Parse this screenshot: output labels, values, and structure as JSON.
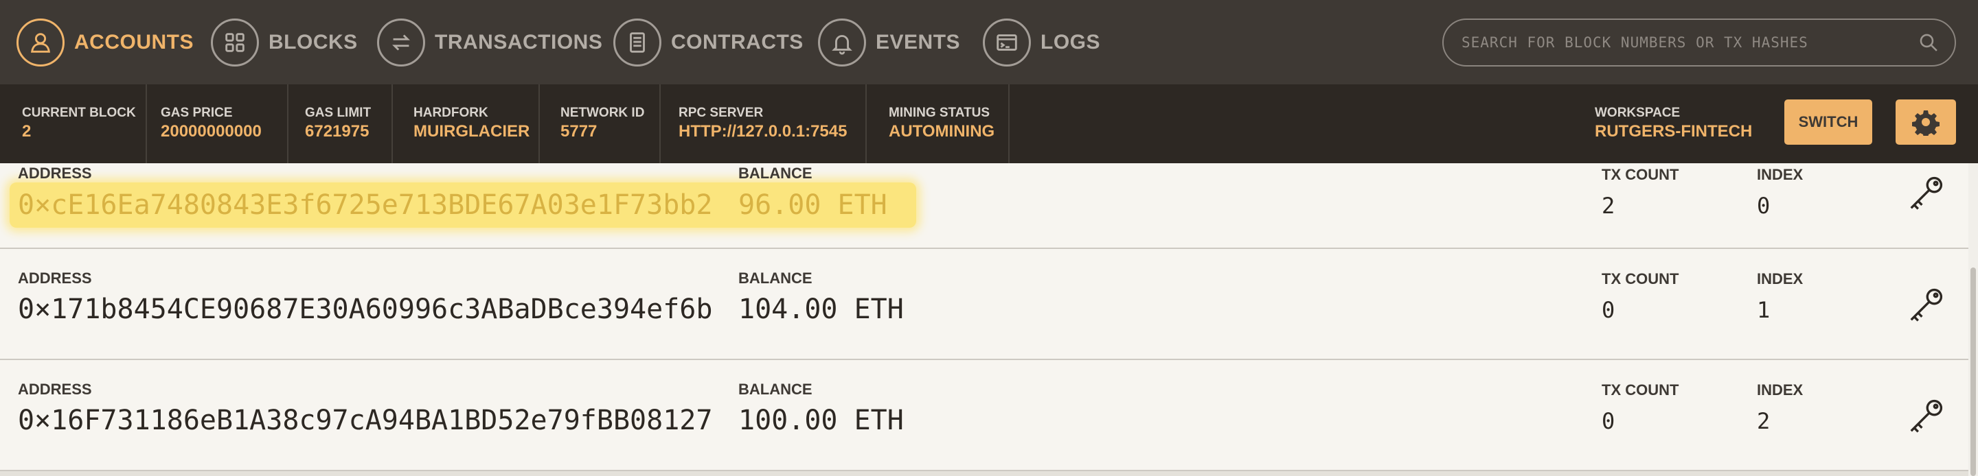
{
  "nav": {
    "items": [
      {
        "label": "ACCOUNTS",
        "icon": "account-icon",
        "active": true
      },
      {
        "label": "BLOCKS",
        "icon": "blocks-icon",
        "active": false
      },
      {
        "label": "TRANSACTIONS",
        "icon": "transactions-icon",
        "active": false
      },
      {
        "label": "CONTRACTS",
        "icon": "contracts-icon",
        "active": false
      },
      {
        "label": "EVENTS",
        "icon": "bell-icon",
        "active": false
      },
      {
        "label": "LOGS",
        "icon": "logs-icon",
        "active": false
      }
    ],
    "search_placeholder": "SEARCH FOR BLOCK NUMBERS OR TX HASHES"
  },
  "status": {
    "current_block": {
      "label": "CURRENT BLOCK",
      "value": "2"
    },
    "gas_price": {
      "label": "GAS PRICE",
      "value": "20000000000"
    },
    "gas_limit": {
      "label": "GAS LIMIT",
      "value": "6721975"
    },
    "hardfork": {
      "label": "HARDFORK",
      "value": "MUIRGLACIER"
    },
    "network_id": {
      "label": "NETWORK ID",
      "value": "5777"
    },
    "rpc_server": {
      "label": "RPC SERVER",
      "value": "HTTP://127.0.0.1:7545"
    },
    "mining_status": {
      "label": "MINING STATUS",
      "value": "AUTOMINING"
    },
    "workspace": {
      "label": "WORKSPACE",
      "value": "RUTGERS-FINTECH"
    },
    "switch_label": "SWITCH"
  },
  "accounts": {
    "labels": {
      "address": "ADDRESS",
      "balance": "BALANCE",
      "tx_count": "TX COUNT",
      "index": "INDEX"
    },
    "rows": [
      {
        "address": "0×cE16Ea7480843E3f6725e713BDE67A03e1F73bb2",
        "balance": "96.00 ETH",
        "tx_count": "2",
        "index": "0",
        "highlighted": true
      },
      {
        "address": "0×171b8454CE90687E30A60996c3ABaDBce394ef6b",
        "balance": "104.00 ETH",
        "tx_count": "0",
        "index": "1",
        "highlighted": false
      },
      {
        "address": "0×16F731186eB1A38c97cA94BA1BD52e79fBB08127",
        "balance": "100.00 ETH",
        "tx_count": "0",
        "index": "2",
        "highlighted": false
      }
    ]
  },
  "colors": {
    "accent": "#f0b46a",
    "nav_bg": "#3e3934",
    "status_bg": "#2d2823",
    "row_bg": "#f7f5f0",
    "highlight": "#fbe57e"
  }
}
